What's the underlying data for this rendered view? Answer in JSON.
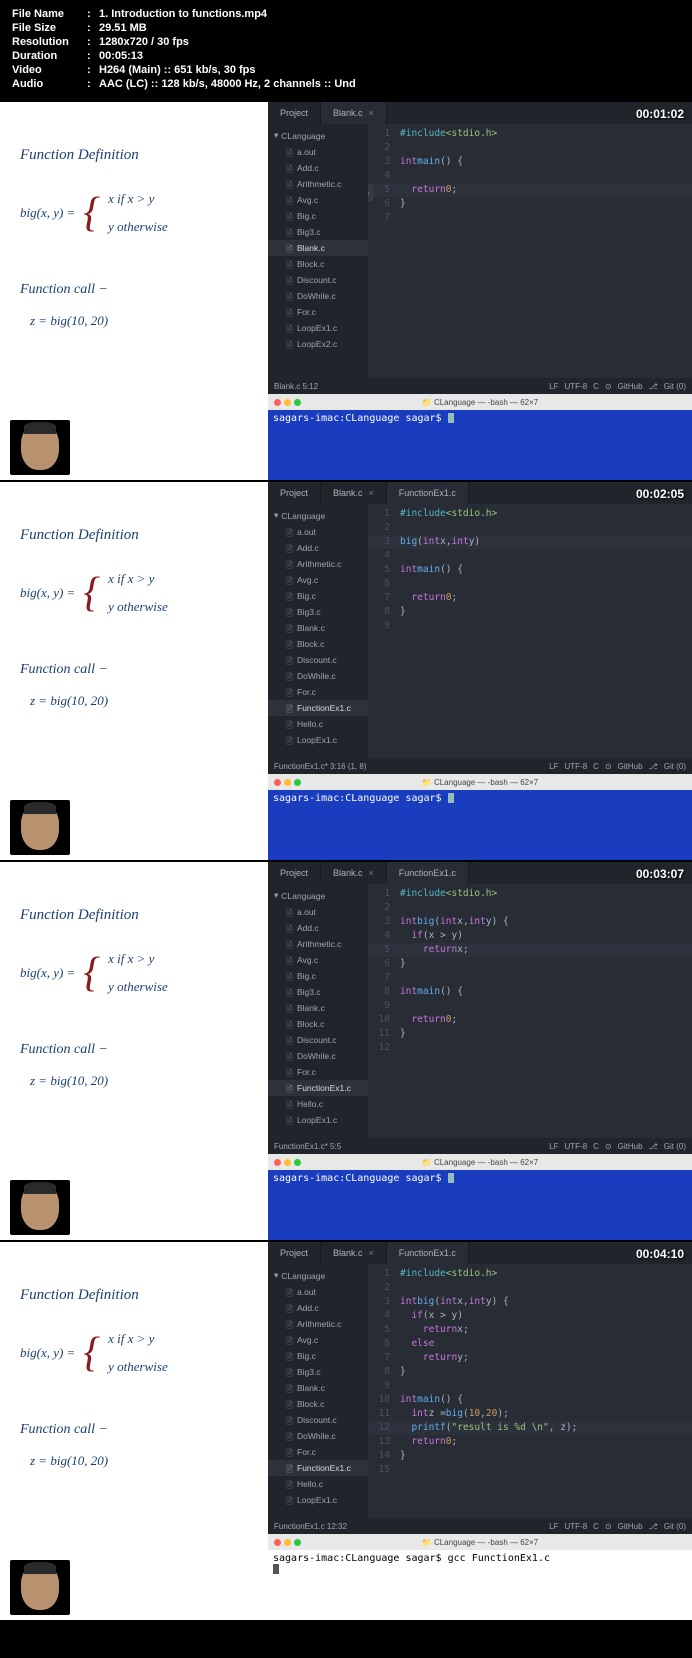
{
  "meta": {
    "filename_label": "File Name",
    "filename": "1. Introduction to functions.mp4",
    "filesize_label": "File Size",
    "filesize": "29.51 MB",
    "resolution_label": "Resolution",
    "resolution": "1280x720 / 30 fps",
    "duration_label": "Duration",
    "duration": "00:05:13",
    "video_label": "Video",
    "video": "H264 (Main) :: 651 kb/s, 30 fps",
    "audio_label": "Audio",
    "audio": "AAC (LC) :: 128 kb/s, 48000 Hz, 2 channels :: Und"
  },
  "slide": {
    "title1": "Function Definition",
    "lhs": "big(x, y)  =",
    "case1": "x if x > y",
    "case2": "y otherwise",
    "title2": "Function call  −",
    "call": "z  =  big(10, 20)"
  },
  "tabs": {
    "project": "Project",
    "blank": "Blank.c",
    "funcex": "FunctionEx1.c"
  },
  "files": {
    "folder": "CLanguage",
    "list": [
      "a.out",
      "Add.c",
      "Arithmetic.c",
      "Avg.c",
      "Big.c",
      "Big3.c",
      "Blank.c",
      "Block.c",
      "Discount.c",
      "DoWhile.c",
      "For.c",
      "LoopEx1.c",
      "LoopEx2.c"
    ],
    "list2": [
      "a.out",
      "Add.c",
      "Arithmetic.c",
      "Avg.c",
      "Big.c",
      "Big3.c",
      "Blank.c",
      "Block.c",
      "Discount.c",
      "DoWhile.c",
      "For.c",
      "FunctionEx1.c",
      "Hello.c",
      "LoopEx1.c"
    ]
  },
  "code1": {
    "l1_a": "#include ",
    "l1_b": "<stdio.h>",
    "l3": "int main() {",
    "l5": "return 0;",
    "l6": "}"
  },
  "code2": {
    "l1_a": "#include ",
    "l1_b": "<stdio.h>",
    "l3": "big(int x, int y)",
    "l5": "int main() {",
    "l7": "return 0;",
    "l8": "}"
  },
  "code3": {
    "l1_a": "#include ",
    "l1_b": "<stdio.h>",
    "l3": "int big(int x, int y) {",
    "l4": "if (x > y)",
    "l5": "return x;",
    "l6": "}",
    "l8": "int main() {",
    "l10": "return 0;",
    "l11": "}"
  },
  "code4": {
    "l1_a": "#include ",
    "l1_b": "<stdio.h>",
    "l3": "int big(int x, int y) {",
    "l4": "if (x > y)",
    "l5": "return x;",
    "l6": "else",
    "l7": "return y;",
    "l8": "}",
    "l10": "int main() {",
    "l11": "int z = big(10, 20);",
    "l12": "printf(\"result is %d \\n\", z);",
    "l13": "return 0;",
    "l14": "}"
  },
  "status": {
    "f1": "Blank.c  5:12",
    "f2": "FunctionEx1.c*  3:16    (1, 8)",
    "f3": "FunctionEx1.c*  5:5",
    "f4": "FunctionEx1.c  12:32",
    "lf": "LF",
    "utf": "UTF-8",
    "c": "C",
    "gh": "GitHub",
    "git": "Git (0)"
  },
  "term": {
    "title": "CLanguage — -bash — 62×7",
    "prompt": "sagars-imac:CLanguage sagar$",
    "cmd4": "gcc FunctionEx1.c"
  },
  "ts": {
    "t1": "00:01:02",
    "t2": "00:02:05",
    "t3": "00:03:07",
    "t4": "00:04:10"
  },
  "icons": {
    "github": "⊙",
    "branch": "⎇",
    "folder": "📁",
    "file": "🗎",
    "close": "×",
    "chev": "‹"
  }
}
